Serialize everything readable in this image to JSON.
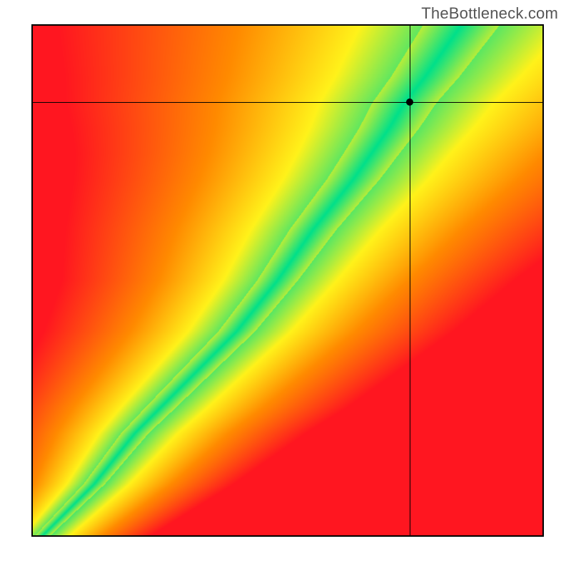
{
  "watermark": "TheBottleneck.com",
  "colors": {
    "green": "#00e08a",
    "yellow": "#fff21a",
    "orange": "#ff8a00",
    "red": "#ff1620",
    "crosshair": "#000000",
    "marker": "#000000"
  },
  "chart_data": {
    "type": "heatmap",
    "title": "",
    "xlabel": "",
    "ylabel": "",
    "xlim": [
      0,
      1
    ],
    "ylim": [
      0,
      1
    ],
    "grid": false,
    "legend": false,
    "marker": {
      "x": 0.74,
      "y": 0.85
    },
    "crosshair": {
      "x": 0.74,
      "y": 0.85
    },
    "ridge": {
      "description": "x position of the green ridge for sampled y values (normalised 0..1)",
      "samples": [
        {
          "y": 0.0,
          "x": 0.02
        },
        {
          "y": 0.1,
          "x": 0.12
        },
        {
          "y": 0.2,
          "x": 0.2
        },
        {
          "y": 0.3,
          "x": 0.3
        },
        {
          "y": 0.4,
          "x": 0.4
        },
        {
          "y": 0.5,
          "x": 0.48
        },
        {
          "y": 0.6,
          "x": 0.55
        },
        {
          "y": 0.7,
          "x": 0.63
        },
        {
          "y": 0.8,
          "x": 0.7
        },
        {
          "y": 0.85,
          "x": 0.73
        },
        {
          "y": 0.9,
          "x": 0.77
        },
        {
          "y": 1.0,
          "x": 0.84
        }
      ]
    },
    "ridge_half_width": {
      "description": "approximate half-width of the green band at sampled y (normalised x units)",
      "samples": [
        {
          "y": 0.0,
          "w": 0.015
        },
        {
          "y": 0.25,
          "w": 0.03
        },
        {
          "y": 0.5,
          "w": 0.04
        },
        {
          "y": 0.75,
          "w": 0.055
        },
        {
          "y": 1.0,
          "w": 0.075
        }
      ]
    },
    "color_stops": [
      {
        "t": 0.0,
        "color": "#00e08a"
      },
      {
        "t": 0.25,
        "color": "#fff21a"
      },
      {
        "t": 0.55,
        "color": "#ff8a00"
      },
      {
        "t": 1.0,
        "color": "#ff1620"
      }
    ]
  }
}
